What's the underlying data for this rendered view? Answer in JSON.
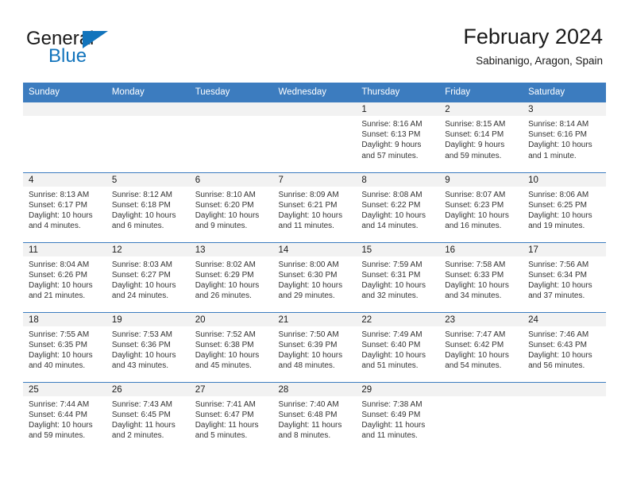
{
  "brand": {
    "name_top": "General",
    "name_bottom": "Blue",
    "accent_color": "#1274bc",
    "logo_icon": "triangle-flag-icon"
  },
  "header": {
    "title": "February 2024",
    "subtitle": "Sabinanigo, Aragon, Spain"
  },
  "calendar": {
    "header_bg": "#3c7cbf",
    "daynum_band_bg": "#f2f2f2",
    "weekday_headers": [
      "Sunday",
      "Monday",
      "Tuesday",
      "Wednesday",
      "Thursday",
      "Friday",
      "Saturday"
    ],
    "weeks": [
      [
        {
          "day": "",
          "lines": []
        },
        {
          "day": "",
          "lines": []
        },
        {
          "day": "",
          "lines": []
        },
        {
          "day": "",
          "lines": []
        },
        {
          "day": "1",
          "lines": [
            "Sunrise: 8:16 AM",
            "Sunset: 6:13 PM",
            "Daylight: 9 hours",
            "and 57 minutes."
          ]
        },
        {
          "day": "2",
          "lines": [
            "Sunrise: 8:15 AM",
            "Sunset: 6:14 PM",
            "Daylight: 9 hours",
            "and 59 minutes."
          ]
        },
        {
          "day": "3",
          "lines": [
            "Sunrise: 8:14 AM",
            "Sunset: 6:16 PM",
            "Daylight: 10 hours",
            "and 1 minute."
          ]
        }
      ],
      [
        {
          "day": "4",
          "lines": [
            "Sunrise: 8:13 AM",
            "Sunset: 6:17 PM",
            "Daylight: 10 hours",
            "and 4 minutes."
          ]
        },
        {
          "day": "5",
          "lines": [
            "Sunrise: 8:12 AM",
            "Sunset: 6:18 PM",
            "Daylight: 10 hours",
            "and 6 minutes."
          ]
        },
        {
          "day": "6",
          "lines": [
            "Sunrise: 8:10 AM",
            "Sunset: 6:20 PM",
            "Daylight: 10 hours",
            "and 9 minutes."
          ]
        },
        {
          "day": "7",
          "lines": [
            "Sunrise: 8:09 AM",
            "Sunset: 6:21 PM",
            "Daylight: 10 hours",
            "and 11 minutes."
          ]
        },
        {
          "day": "8",
          "lines": [
            "Sunrise: 8:08 AM",
            "Sunset: 6:22 PM",
            "Daylight: 10 hours",
            "and 14 minutes."
          ]
        },
        {
          "day": "9",
          "lines": [
            "Sunrise: 8:07 AM",
            "Sunset: 6:23 PM",
            "Daylight: 10 hours",
            "and 16 minutes."
          ]
        },
        {
          "day": "10",
          "lines": [
            "Sunrise: 8:06 AM",
            "Sunset: 6:25 PM",
            "Daylight: 10 hours",
            "and 19 minutes."
          ]
        }
      ],
      [
        {
          "day": "11",
          "lines": [
            "Sunrise: 8:04 AM",
            "Sunset: 6:26 PM",
            "Daylight: 10 hours",
            "and 21 minutes."
          ]
        },
        {
          "day": "12",
          "lines": [
            "Sunrise: 8:03 AM",
            "Sunset: 6:27 PM",
            "Daylight: 10 hours",
            "and 24 minutes."
          ]
        },
        {
          "day": "13",
          "lines": [
            "Sunrise: 8:02 AM",
            "Sunset: 6:29 PM",
            "Daylight: 10 hours",
            "and 26 minutes."
          ]
        },
        {
          "day": "14",
          "lines": [
            "Sunrise: 8:00 AM",
            "Sunset: 6:30 PM",
            "Daylight: 10 hours",
            "and 29 minutes."
          ]
        },
        {
          "day": "15",
          "lines": [
            "Sunrise: 7:59 AM",
            "Sunset: 6:31 PM",
            "Daylight: 10 hours",
            "and 32 minutes."
          ]
        },
        {
          "day": "16",
          "lines": [
            "Sunrise: 7:58 AM",
            "Sunset: 6:33 PM",
            "Daylight: 10 hours",
            "and 34 minutes."
          ]
        },
        {
          "day": "17",
          "lines": [
            "Sunrise: 7:56 AM",
            "Sunset: 6:34 PM",
            "Daylight: 10 hours",
            "and 37 minutes."
          ]
        }
      ],
      [
        {
          "day": "18",
          "lines": [
            "Sunrise: 7:55 AM",
            "Sunset: 6:35 PM",
            "Daylight: 10 hours",
            "and 40 minutes."
          ]
        },
        {
          "day": "19",
          "lines": [
            "Sunrise: 7:53 AM",
            "Sunset: 6:36 PM",
            "Daylight: 10 hours",
            "and 43 minutes."
          ]
        },
        {
          "day": "20",
          "lines": [
            "Sunrise: 7:52 AM",
            "Sunset: 6:38 PM",
            "Daylight: 10 hours",
            "and 45 minutes."
          ]
        },
        {
          "day": "21",
          "lines": [
            "Sunrise: 7:50 AM",
            "Sunset: 6:39 PM",
            "Daylight: 10 hours",
            "and 48 minutes."
          ]
        },
        {
          "day": "22",
          "lines": [
            "Sunrise: 7:49 AM",
            "Sunset: 6:40 PM",
            "Daylight: 10 hours",
            "and 51 minutes."
          ]
        },
        {
          "day": "23",
          "lines": [
            "Sunrise: 7:47 AM",
            "Sunset: 6:42 PM",
            "Daylight: 10 hours",
            "and 54 minutes."
          ]
        },
        {
          "day": "24",
          "lines": [
            "Sunrise: 7:46 AM",
            "Sunset: 6:43 PM",
            "Daylight: 10 hours",
            "and 56 minutes."
          ]
        }
      ],
      [
        {
          "day": "25",
          "lines": [
            "Sunrise: 7:44 AM",
            "Sunset: 6:44 PM",
            "Daylight: 10 hours",
            "and 59 minutes."
          ]
        },
        {
          "day": "26",
          "lines": [
            "Sunrise: 7:43 AM",
            "Sunset: 6:45 PM",
            "Daylight: 11 hours",
            "and 2 minutes."
          ]
        },
        {
          "day": "27",
          "lines": [
            "Sunrise: 7:41 AM",
            "Sunset: 6:47 PM",
            "Daylight: 11 hours",
            "and 5 minutes."
          ]
        },
        {
          "day": "28",
          "lines": [
            "Sunrise: 7:40 AM",
            "Sunset: 6:48 PM",
            "Daylight: 11 hours",
            "and 8 minutes."
          ]
        },
        {
          "day": "29",
          "lines": [
            "Sunrise: 7:38 AM",
            "Sunset: 6:49 PM",
            "Daylight: 11 hours",
            "and 11 minutes."
          ]
        },
        {
          "day": "",
          "lines": []
        },
        {
          "day": "",
          "lines": []
        }
      ]
    ]
  }
}
